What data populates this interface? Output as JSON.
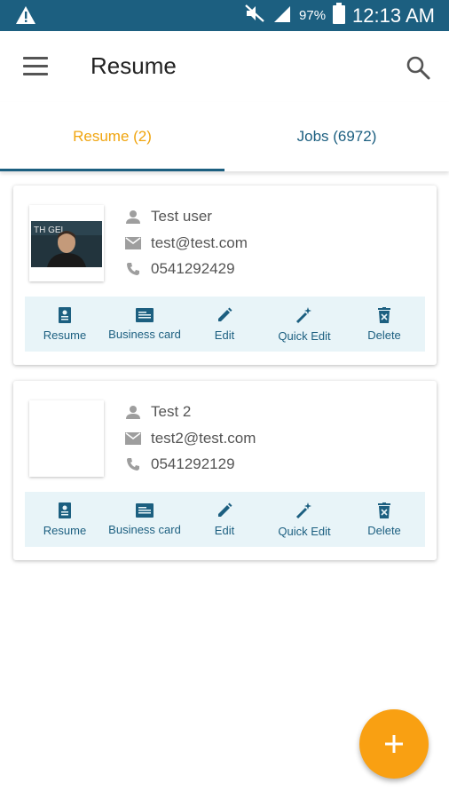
{
  "status_bar": {
    "battery": "97%",
    "time": "12:13 AM",
    "icons": [
      "warning-icon",
      "mute-icon",
      "signal-icon",
      "battery-icon"
    ]
  },
  "toolbar": {
    "title": "Resume",
    "icons": [
      "menu-icon",
      "search-icon"
    ]
  },
  "tabs": [
    {
      "label": "Resume (2)",
      "active": true,
      "color": "#f0a510"
    },
    {
      "label": "Jobs (6972)",
      "active": false,
      "color": "#1c5f80"
    }
  ],
  "actions": {
    "resume": "Resume",
    "business_card": "Business card",
    "edit": "Edit",
    "quick_edit": "Quick Edit",
    "delete": "Delete"
  },
  "resumes": [
    {
      "name": "Test user",
      "email": "test@test.com",
      "phone": "0541292429",
      "has_photo": true,
      "photo_caption": "TH  GEL"
    },
    {
      "name": "Test 2",
      "email": "test2@test.com",
      "phone": "0541292129",
      "has_photo": false
    }
  ],
  "colors": {
    "primary": "#1c5f80",
    "accent": "#f0a510",
    "fab": "#f9a012",
    "action_bar_bg": "#e8f4f8"
  }
}
